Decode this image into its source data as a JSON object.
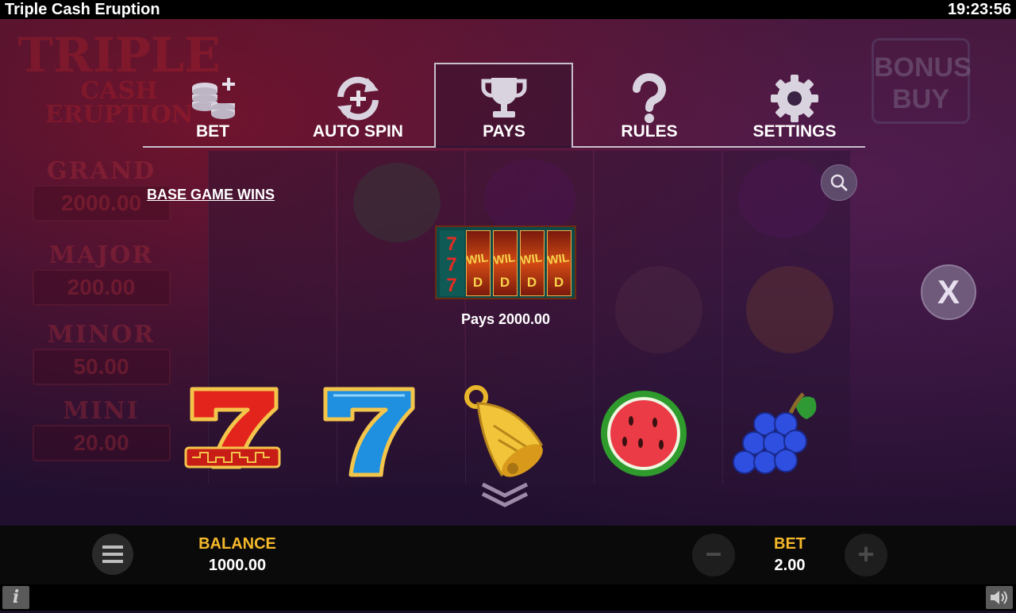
{
  "app": {
    "title": "Triple Cash Eruption",
    "clock": "19:23:56"
  },
  "background": {
    "logo_line1": "TRIPLE",
    "logo_line2": "CASH ERUPTION",
    "bonus_buy": "BONUS BUY",
    "jackpots": [
      {
        "name": "GRAND",
        "value": "2000.00"
      },
      {
        "name": "MAJOR",
        "value": "200.00"
      },
      {
        "name": "MINOR",
        "value": "50.00"
      },
      {
        "name": "MINI",
        "value": "20.00"
      }
    ]
  },
  "menu": {
    "tabs": [
      {
        "label": "BET",
        "icon": "coins-icon",
        "active": false
      },
      {
        "label": "AUTO SPIN",
        "icon": "autospin-icon",
        "active": false
      },
      {
        "label": "PAYS",
        "icon": "trophy-icon",
        "active": true
      },
      {
        "label": "RULES",
        "icon": "question-icon",
        "active": false
      },
      {
        "label": "SETTINGS",
        "icon": "gear-icon",
        "active": false
      }
    ]
  },
  "pays": {
    "section_title": "BASE GAME WINS",
    "combo": {
      "symbols": [
        "7-stack",
        "WILD",
        "WILD",
        "WILD",
        "WILD"
      ],
      "wild_text": "WILD"
    },
    "combo_pays": "Pays 2000.00",
    "symbols": [
      "red-seven",
      "blue-seven",
      "bell",
      "watermelon",
      "grapes"
    ]
  },
  "controls": {
    "close_label": "X",
    "balance_label": "BALANCE",
    "balance_value": "1000.00",
    "bet_label": "BET",
    "bet_value": "2.00",
    "minus_label": "−",
    "plus_label": "+",
    "info_label": "i"
  },
  "colors": {
    "accent": "#f5b82a",
    "tab_line": "#c7c0cc",
    "button": "#6f5a7c"
  }
}
